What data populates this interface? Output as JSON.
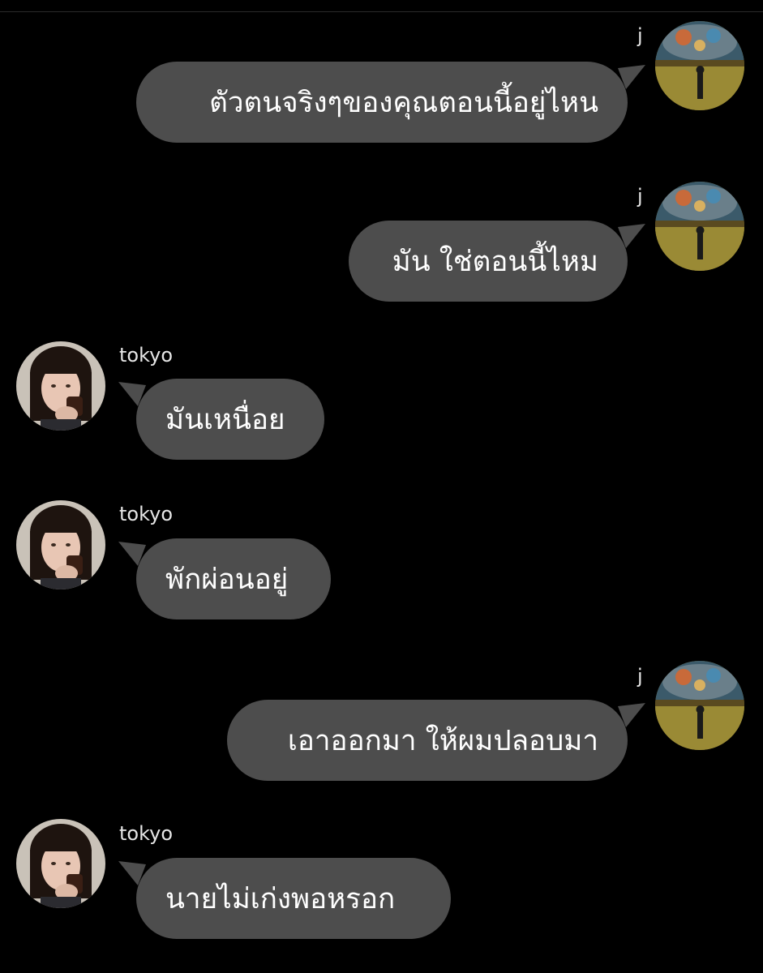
{
  "conversation": {
    "messages": [
      {
        "sender": "j",
        "side": "right",
        "text": "ตัวตนจริงๆของคุณตอนนี้อยู่ไหน",
        "avatar_icon": "painting-avatar-icon"
      },
      {
        "sender": "j",
        "side": "right",
        "text": "มัน ใช่ตอนนี้ไหม",
        "avatar_icon": "painting-avatar-icon"
      },
      {
        "sender": "tokyo",
        "side": "left",
        "text": "มันเหนื่อย",
        "avatar_icon": "woman-drinking-avatar-icon"
      },
      {
        "sender": "tokyo",
        "side": "left",
        "text": "พักผ่อนอยู่",
        "avatar_icon": "woman-drinking-avatar-icon"
      },
      {
        "sender": "j",
        "side": "right",
        "text": "เอาออกมา ให้ผมปลอบมา",
        "avatar_icon": "painting-avatar-icon"
      },
      {
        "sender": "tokyo",
        "side": "left",
        "text": "นายไม่เก่งพอหรอก",
        "avatar_icon": "woman-drinking-avatar-icon"
      }
    ]
  },
  "colors": {
    "background": "#000000",
    "bubble": "#4d4d4d",
    "text": "#ffffff",
    "name": "#e6e6e6"
  }
}
